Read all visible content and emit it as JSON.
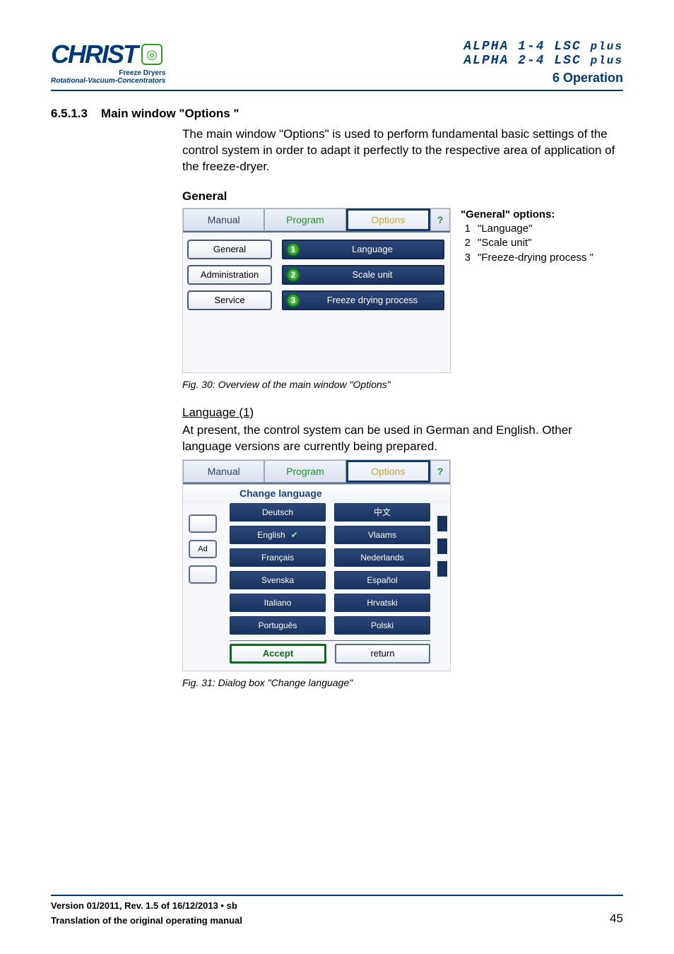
{
  "header": {
    "logo_name": "CHRIST",
    "logo_sub1": "Freeze Dryers",
    "logo_sub2": "Rotational-Vacuum-Concentrators",
    "product1": "ALPHA 1-4 LSC ",
    "product2": "ALPHA 2-4 LSC ",
    "plus": "plus",
    "section": "6 Operation"
  },
  "section_num": "6.5.1.3",
  "section_title": "Main window \"Options \"",
  "para1": "The main window \"Options\" is used to perform fundamental basic settings of the control system in order to adapt it perfectly to the respective area of application of the freeze-dryer.",
  "general_head": "General",
  "tabs": {
    "manual": "Manual",
    "program": "Program",
    "options": "Options",
    "help": "?"
  },
  "left_buttons": {
    "general": "General",
    "admin": "Administration",
    "service": "Service"
  },
  "right_buttons": {
    "lang": "Language",
    "scale": "Scale unit",
    "freeze": "Freeze drying process"
  },
  "badges": {
    "b1": "1",
    "b2": "2",
    "b3": "3"
  },
  "legend": {
    "title": "\"General\" options:",
    "items": [
      {
        "n": "1",
        "t": "\"Language\""
      },
      {
        "n": "2",
        "t": "\"Scale unit\""
      },
      {
        "n": "3",
        "t": "\"Freeze-drying process \""
      }
    ]
  },
  "fig30": "Fig. 30: Overview of the main window \"Options\"",
  "lang_head": "Language (1)",
  "para2": "At present, the control system can be used in German and English. Other language versions are currently being prepared.",
  "dialog_title": "Change language",
  "side": {
    "ad": "Ad"
  },
  "languages": {
    "deutsch": "Deutsch",
    "zh": "中文",
    "english": "English",
    "vlaams": "Vlaams",
    "francais": "Français",
    "nederlands": "Nederlands",
    "svenska": "Svenska",
    "espanol": "Español",
    "italiano": "Italiano",
    "hrvatski": "Hrvatski",
    "portugues": "Português",
    "polski": "Polski"
  },
  "actions": {
    "accept": "Accept",
    "return": "return"
  },
  "fig31": "Fig. 31: Dialog box \"Change language\"",
  "footer": {
    "line1": "Version 01/2011, Rev. 1.5 of 16/12/2013 • sb",
    "line2": "Translation of the original operating manual",
    "page": "45"
  }
}
